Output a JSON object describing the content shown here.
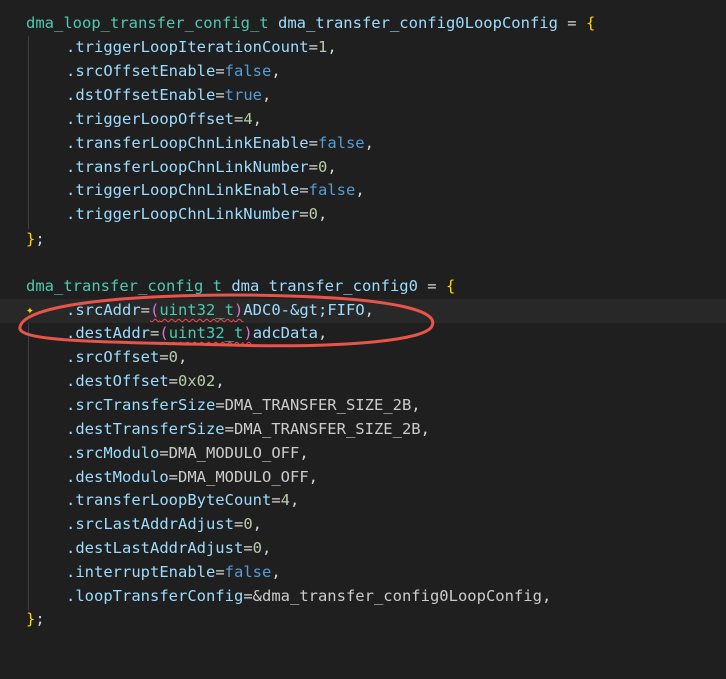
{
  "editor": {
    "theme": {
      "background": "#1f1f1f",
      "annotation_color": "#e8534a"
    },
    "loop_struct": {
      "type": "dma_loop_transfer_config_t",
      "name": "dma_transfer_config0LoopConfig",
      "assign": " = ",
      "open": "{",
      "fields": [
        {
          "key": ".triggerLoopIterationCount",
          "eq": "=",
          "val": "1",
          "kind": "num",
          "end": ","
        },
        {
          "key": ".srcOffsetEnable",
          "eq": "=",
          "val": "false",
          "kind": "bool",
          "end": ","
        },
        {
          "key": ".dstOffsetEnable",
          "eq": "=",
          "val": "true",
          "kind": "bool",
          "end": ","
        },
        {
          "key": ".triggerLoopOffset",
          "eq": "=",
          "val": "4",
          "kind": "num",
          "end": ","
        },
        {
          "key": ".transferLoopChnLinkEnable",
          "eq": "=",
          "val": "false",
          "kind": "bool",
          "end": ","
        },
        {
          "key": ".transferLoopChnLinkNumber",
          "eq": "=",
          "val": "0",
          "kind": "num",
          "end": ","
        },
        {
          "key": ".triggerLoopChnLinkEnable",
          "eq": "=",
          "val": "false",
          "kind": "bool",
          "end": ","
        },
        {
          "key": ".triggerLoopChnLinkNumber",
          "eq": "=",
          "val": "0",
          "kind": "num",
          "end": ","
        }
      ],
      "close": "}",
      "semicolon": ";"
    },
    "transfer_struct": {
      "type": "dma_transfer_config_t",
      "name": "dma_transfer_config0",
      "assign": " = ",
      "open": "{",
      "src_addr": {
        "key": ".srcAddr",
        "eq": "=",
        "paren_open": "(",
        "cast": "uint32_t",
        "paren_close": ")",
        "rest": "ADC0-&gt;FIFO",
        "end": ","
      },
      "dest_addr": {
        "key": ".destAddr",
        "eq": "=",
        "paren_open": "(",
        "cast": "uint32_t",
        "paren_close": ")",
        "rest": "adcData",
        "end": ","
      },
      "fields": [
        {
          "key": ".srcOffset",
          "eq": "=",
          "val": "0",
          "kind": "num",
          "end": ","
        },
        {
          "key": ".destOffset",
          "eq": "=",
          "val": "0x02",
          "kind": "num",
          "end": ","
        },
        {
          "key": ".srcTransferSize",
          "eq": "=",
          "val": "DMA_TRANSFER_SIZE_2B",
          "kind": "plain",
          "end": ","
        },
        {
          "key": ".destTransferSize",
          "eq": "=",
          "val": "DMA_TRANSFER_SIZE_2B",
          "kind": "plain",
          "end": ","
        },
        {
          "key": ".srcModulo",
          "eq": "=",
          "val": "DMA_MODULO_OFF",
          "kind": "plain",
          "end": ","
        },
        {
          "key": ".destModulo",
          "eq": "=",
          "val": "DMA_MODULO_OFF",
          "kind": "plain",
          "end": ","
        },
        {
          "key": ".transferLoopByteCount",
          "eq": "=",
          "val": "4",
          "kind": "num",
          "end": ","
        },
        {
          "key": ".srcLastAddrAdjust",
          "eq": "=",
          "val": "0",
          "kind": "num",
          "end": ","
        },
        {
          "key": ".destLastAddrAdjust",
          "eq": "=",
          "val": "0",
          "kind": "num",
          "end": ","
        },
        {
          "key": ".interruptEnable",
          "eq": "=",
          "val": "false",
          "kind": "bool",
          "end": ","
        },
        {
          "key": ".loopTransferConfig",
          "eq": "=",
          "val": "&dma_transfer_config0LoopConfig",
          "kind": "plain",
          "end": ","
        }
      ],
      "close": "}",
      "semicolon": ";"
    },
    "gutter_icon": "lightbulb-sparkle-icon"
  }
}
